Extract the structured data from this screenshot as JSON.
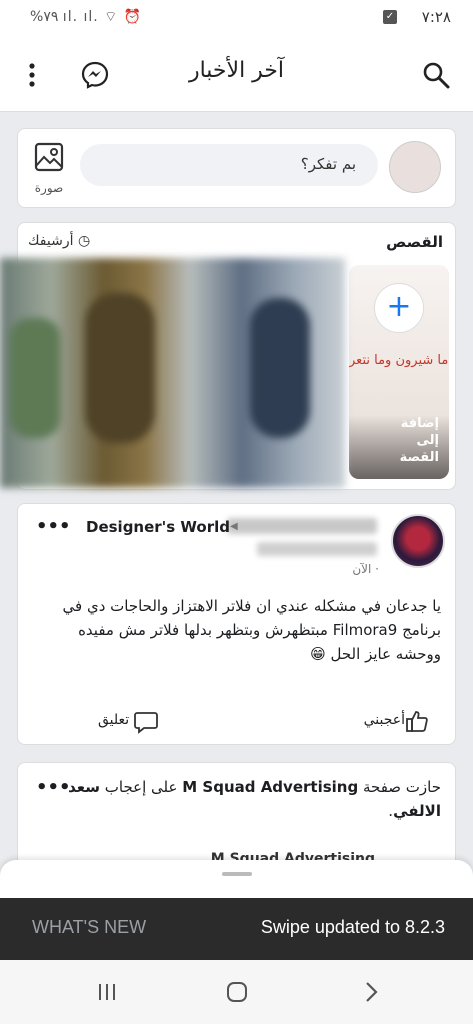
{
  "status_bar": {
    "time": "٧:٢٨",
    "left_text": "%٧٩ ıl. ıl. ⌔ ⏰"
  },
  "header": {
    "title": "آخر الأخبار"
  },
  "composer": {
    "placeholder": "بم تفكر؟",
    "photo_label": "صورة"
  },
  "stories": {
    "title": "القصص",
    "archive_label": "أرشيفك",
    "create_label": "إضافة\nإلى\nالقصة",
    "create_plus": "+",
    "graffiti": "كله ما شيرون وما نتعر"
  },
  "post1": {
    "group": "Designer's World",
    "time": "الآن · ",
    "body": "يا جدعان في مشكله عندي ان فلاتر الاهتزاز والحاجات دي في برنامج Filmora9 مبتظهرش وبتظهر بدلها فلاتر مش مفيده ووحشه عايز الحل 😁",
    "like_label": "أعجبني",
    "comment_label": "تعليق",
    "more": "•••"
  },
  "post2": {
    "text_prefix": "حازت صفحة ",
    "page_name": "M Squad Advertising",
    "text_mid": " على إعجاب ",
    "person": "سعد الالفي",
    "text_end": ".",
    "peek": "M Squad Advertising",
    "more": "•••"
  },
  "snackbar": {
    "message": "Swipe updated to 8.2.3",
    "action": "WHAT'S NEW"
  },
  "colors": {
    "accent": "#1877f2",
    "snackbar_bg": "#2b2b2b"
  }
}
